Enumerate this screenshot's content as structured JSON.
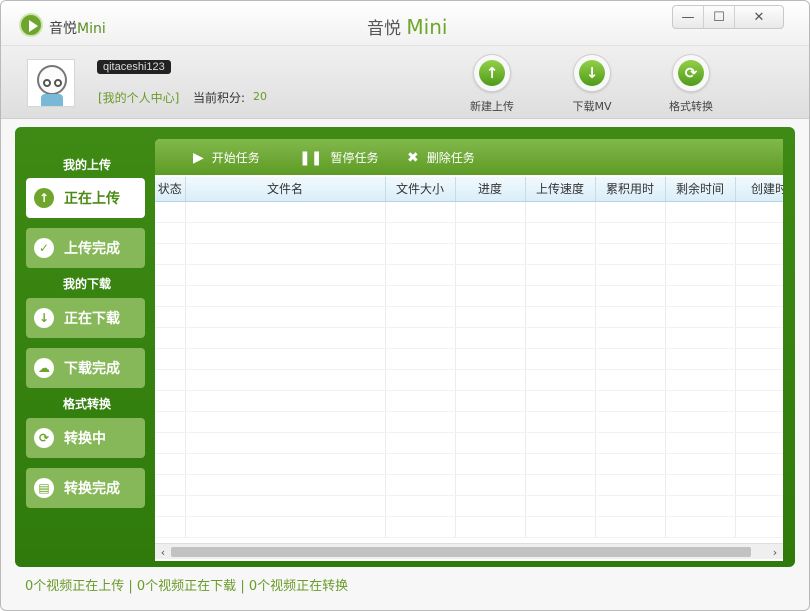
{
  "app": {
    "brand_prefix": "音悦",
    "brand_suffix": "Mini",
    "title_prefix": "音悦",
    "title_suffix": "Mini"
  },
  "window_controls": {
    "minimize": "—",
    "maximize": "☐",
    "close": "✕"
  },
  "user": {
    "username": "qitaceshi123",
    "profile_link": "[我的个人中心]",
    "points_label": "当前积分:",
    "points_value": "20"
  },
  "toolbar": [
    {
      "label": "新建上传",
      "icon": "upload-arrow-icon",
      "glyph": "↑"
    },
    {
      "label": "下载MV",
      "icon": "download-arrow-icon",
      "glyph": "↓"
    },
    {
      "label": "格式转换",
      "icon": "convert-icon",
      "glyph": "⟳"
    }
  ],
  "sidebar": {
    "upload_heading": "我的上传",
    "download_heading": "我的下载",
    "convert_heading": "格式转换",
    "items": [
      {
        "label": "正在上传",
        "glyph": "↑",
        "icon": "upload-icon",
        "active": true
      },
      {
        "label": "上传完成",
        "glyph": "✓",
        "icon": "check-icon",
        "active": false
      },
      {
        "label": "正在下载",
        "glyph": "↓",
        "icon": "download-icon",
        "active": false
      },
      {
        "label": "下载完成",
        "glyph": "☁",
        "icon": "cloud-icon",
        "active": false
      },
      {
        "label": "转换中",
        "glyph": "⟳",
        "icon": "convert-icon",
        "active": false
      },
      {
        "label": "转换完成",
        "glyph": "▤",
        "icon": "list-icon",
        "active": false
      }
    ]
  },
  "tasks": {
    "start": "开始任务",
    "pause": "暂停任务",
    "delete": "删除任务"
  },
  "table": {
    "columns": [
      "状态",
      "文件名",
      "文件大小",
      "进度",
      "上传速度",
      "累积用时",
      "剩余时间",
      "创建时间"
    ]
  },
  "status": "0个视频正在上传 | 0个视频正在下载 | 0个视频正在转换"
}
